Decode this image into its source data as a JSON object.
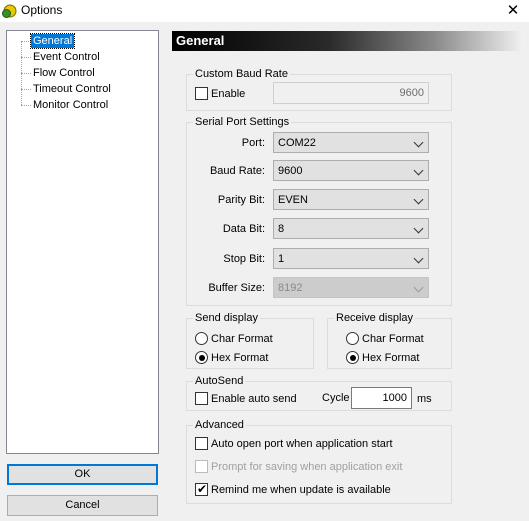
{
  "window": {
    "title": "Options",
    "close_glyph": "✕"
  },
  "tree": {
    "items": [
      {
        "label": "General",
        "selected": true
      },
      {
        "label": "Event Control"
      },
      {
        "label": "Flow Control"
      },
      {
        "label": "Timeout Control"
      },
      {
        "label": "Monitor Control"
      }
    ]
  },
  "buttons": {
    "ok": "OK",
    "cancel": "Cancel"
  },
  "header": {
    "title": "General"
  },
  "custom_baud": {
    "legend": "Custom Baud Rate",
    "enable_label": "Enable",
    "enabled": false,
    "value": "9600"
  },
  "serial": {
    "legend": "Serial Port Settings",
    "port": {
      "label": "Port:",
      "value": "COM22"
    },
    "baud": {
      "label": "Baud Rate:",
      "value": "9600"
    },
    "parity": {
      "label": "Parity Bit:",
      "value": "EVEN"
    },
    "data": {
      "label": "Data Bit:",
      "value": "8"
    },
    "stop": {
      "label": "Stop Bit:",
      "value": "1"
    },
    "buffer": {
      "label": "Buffer Size:",
      "value": "8192"
    }
  },
  "send_display": {
    "legend": "Send display",
    "char_label": "Char Format",
    "hex_label": "Hex  Format",
    "selected": "hex"
  },
  "receive_display": {
    "legend": "Receive display",
    "char_label": "Char Format",
    "hex_label": "Hex  Format",
    "selected": "hex"
  },
  "autosend": {
    "legend": "AutoSend",
    "enable_label": "Enable auto send",
    "enabled": false,
    "cycle_label": "Cycle",
    "cycle_value": "1000",
    "unit": "ms"
  },
  "advanced": {
    "legend": "Advanced",
    "auto_open_label": "Auto open port when application start",
    "auto_open": false,
    "prompt_save_label": "Prompt for saving when application exit",
    "prompt_save": false,
    "remind_label": "Remind me when update is available",
    "remind": true
  },
  "colors": {
    "accent": "#0078d7",
    "window_bg": "#f0f0f0",
    "header_start": "#000000"
  },
  "icons": {
    "app": "app-icon",
    "close": "close-icon",
    "dropdown": "chevron-down-icon",
    "check": "checkmark-icon"
  }
}
